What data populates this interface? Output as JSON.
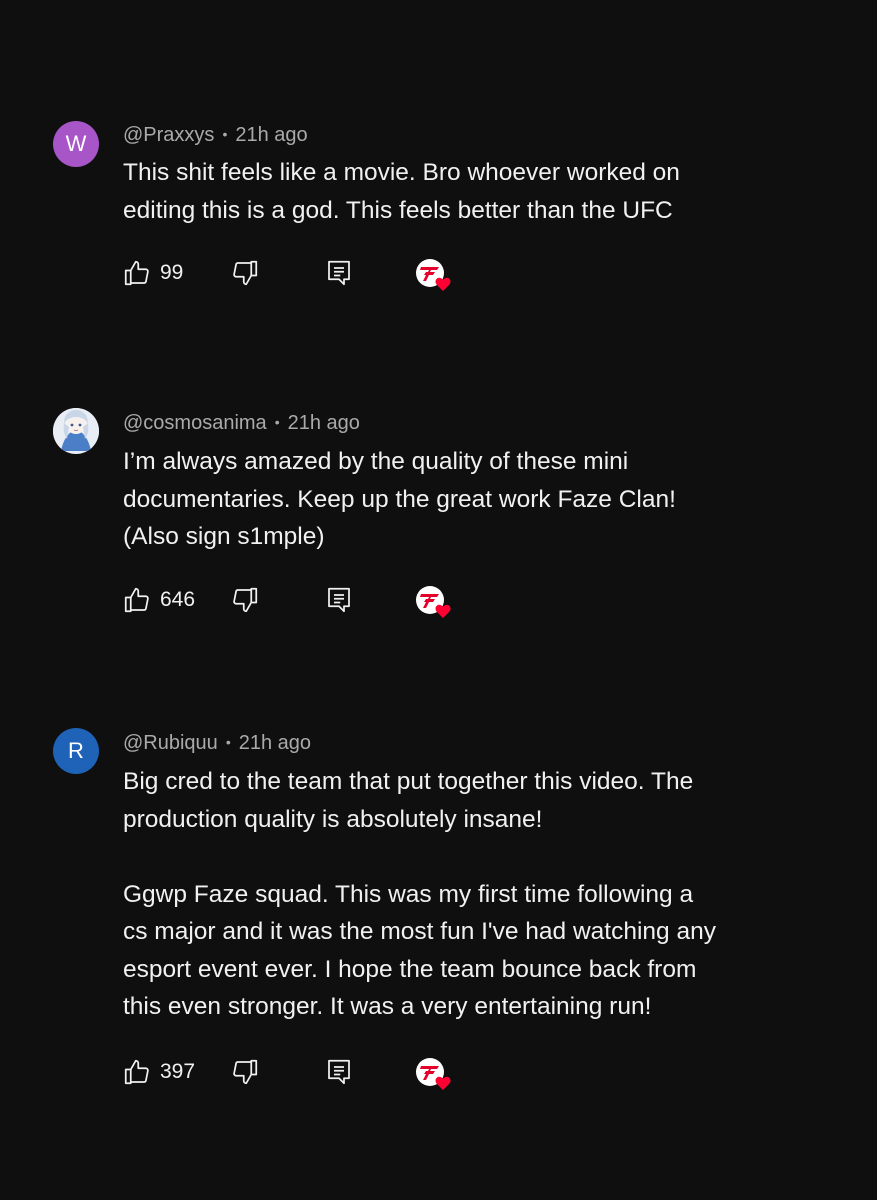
{
  "comments": [
    {
      "avatar_letter": "W",
      "avatar_color": "#a855c7",
      "username": "@Praxxys",
      "time": "21h ago",
      "text": "This shit feels like a movie. Bro whoever worked on\nediting this is a god. This feels better than the UFC",
      "likes": "99"
    },
    {
      "avatar_letter": "",
      "avatar_color": "#e8eef7",
      "avatar_image": "anime-character-avatar",
      "username": "@cosmosanima",
      "time": "21h ago",
      "text": "I’m always amazed by the quality of these mini\ndocumentaries. Keep up the great work Faze Clan!\n(Also sign s1mple)",
      "likes": "646"
    },
    {
      "avatar_letter": "R",
      "avatar_color": "#1e63b8",
      "username": "@Rubiquu",
      "time": "21h ago",
      "text": "Big cred to the team that put together this video. The\nproduction quality is absolutely insane!\n\nGgwp Faze squad. This was my first time following a\ncs major and it was the most fun I've had watching any\nesport event ever. I hope the team bounce back from\nthis even stronger. It was a very entertaining run!",
      "likes": "397"
    }
  ],
  "icons": {
    "like": "thumbs-up-icon",
    "dislike": "thumbs-down-icon",
    "reply": "reply-comment-icon",
    "creator_heart": "faze-clan-heart-icon"
  },
  "colors": {
    "background": "#0f0f0f",
    "text": "#f1f1f1",
    "meta": "#aaaaaa",
    "heart": "#ff0033",
    "faze_red": "#e4002b"
  }
}
